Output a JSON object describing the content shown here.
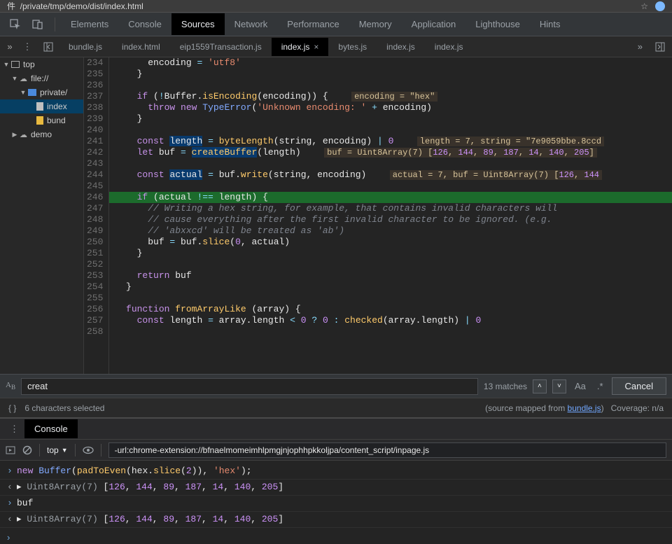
{
  "address_bar": {
    "path": "/private/tmp/demo/dist/index.html"
  },
  "top_tabs": [
    "Elements",
    "Console",
    "Sources",
    "Network",
    "Performance",
    "Memory",
    "Application",
    "Lighthouse",
    "Hints"
  ],
  "active_top_tab": "Sources",
  "file_tabs": [
    "bundle.js",
    "index.html",
    "eip1559Transaction.js",
    "index.js",
    "bytes.js",
    "index.js",
    "index.js"
  ],
  "file_tab_active_index": 3,
  "sidebar": {
    "items": [
      {
        "depth": 0,
        "twisty": "▼",
        "icon": "window",
        "label": "top"
      },
      {
        "depth": 1,
        "twisty": "▼",
        "icon": "cloud",
        "label": "file://"
      },
      {
        "depth": 2,
        "twisty": "▼",
        "icon": "folder",
        "label": "private/"
      },
      {
        "depth": 3,
        "twisty": "",
        "icon": "file",
        "label": "index",
        "hl": true
      },
      {
        "depth": 3,
        "twisty": "",
        "icon": "file-y",
        "label": "bund"
      },
      {
        "depth": 1,
        "twisty": "▶",
        "icon": "cloud",
        "label": "demo"
      }
    ]
  },
  "code": {
    "first_line": 234,
    "lines": [
      {
        "n": 234,
        "html": "      encoding <span class='tok-op'>=</span> <span class='tok-str'>'utf8'</span>"
      },
      {
        "n": 235,
        "html": "    }"
      },
      {
        "n": 236,
        "html": ""
      },
      {
        "n": 237,
        "html": "    <span class='tok-kw'>if</span> (<span class='tok-op'>!</span>Buffer.<span class='tok-fn'>isEncoding</span>(encoding)) {   <span class='inline-val'>encoding = \"hex\"</span>"
      },
      {
        "n": 238,
        "html": "      <span class='tok-kw'>throw</span> <span class='tok-kw'>new</span> <span class='tok-type'>TypeError</span>(<span class='tok-str'>'Unknown encoding: '</span> <span class='tok-op'>+</span> encoding)"
      },
      {
        "n": 239,
        "html": "    }"
      },
      {
        "n": 240,
        "html": ""
      },
      {
        "n": 241,
        "html": "    <span class='tok-kw'>const</span> <span class='sel-bg'>length</span> <span class='tok-op'>=</span> <span class='tok-fn'>byteLength</span>(string, encoding) <span class='tok-op'>|</span> <span class='tok-num'>0</span>   <span class='inline-val'>length = 7, string = \"7e9059bbe.8ccd</span>"
      },
      {
        "n": 242,
        "html": "    <span class='tok-kw'>let</span> buf <span class='tok-op'>=</span> <span class='tok-fn sel-bg'>createBuffer</span>(length)   <span class='inline-val'>buf = Uint8Array(7) [<span class='tok-num'>126</span>, <span class='tok-num'>144</span>, <span class='tok-num'>89</span>, <span class='tok-num'>187</span>, <span class='tok-num'>14</span>, <span class='tok-num'>140</span>, <span class='tok-num'>205</span>]</span>"
      },
      {
        "n": 243,
        "html": ""
      },
      {
        "n": 244,
        "html": "    <span class='tok-kw'>const</span> <span class='sel-bg'>actual</span> <span class='tok-op'>=</span> buf.<span class='tok-fn'>write</span>(string, encoding)   <span class='inline-val'>actual = 7, buf = Uint8Array(7) [<span class='tok-num'>126</span>, <span class='tok-num'>144</span></span>"
      },
      {
        "n": 245,
        "html": ""
      },
      {
        "n": 246,
        "hl": "green",
        "html": "    <span class='tok-kw'>if</span> (actual <span class='tok-op'>!==</span> length) {"
      },
      {
        "n": 247,
        "html": "      <span class='tok-com'>// Writing a hex string, for example, that contains invalid characters will</span>"
      },
      {
        "n": 248,
        "html": "      <span class='tok-com'>// cause everything after the first invalid character to be ignored. (e.g.</span>"
      },
      {
        "n": 249,
        "html": "      <span class='tok-com'>// 'abxxcd' will be treated as 'ab')</span>"
      },
      {
        "n": 250,
        "html": "      buf <span class='tok-op'>=</span> buf.<span class='tok-fn'>slice</span>(<span class='tok-num'>0</span>, actual)"
      },
      {
        "n": 251,
        "html": "    }"
      },
      {
        "n": 252,
        "html": ""
      },
      {
        "n": 253,
        "html": "    <span class='tok-kw'>return</span> buf"
      },
      {
        "n": 254,
        "html": "  }"
      },
      {
        "n": 255,
        "html": ""
      },
      {
        "n": 256,
        "html": "  <span class='tok-kw'>function</span> <span class='tok-fn'>fromArrayLike</span> (array) {"
      },
      {
        "n": 257,
        "html": "    <span class='tok-kw'>const</span> length <span class='tok-op'>=</span> array.length <span class='tok-op'>&lt;</span> <span class='tok-num'>0</span> <span class='tok-op'>?</span> <span class='tok-num'>0</span> <span class='tok-op'>:</span> <span class='tok-fn'>checked</span>(array.length) <span class='tok-op'>|</span> <span class='tok-num'>0</span>"
      },
      {
        "n": 258,
        "html": ""
      }
    ]
  },
  "search": {
    "value": "creat",
    "matches": "13 matches",
    "case": "Aa",
    "regex": ".*",
    "cancel": "Cancel"
  },
  "status": {
    "selection": "6 characters selected",
    "mapped_prefix": "(source mapped from ",
    "mapped_link": "bundle.js",
    "mapped_suffix": ")",
    "coverage": "Coverage: n/a"
  },
  "console": {
    "tab": "Console",
    "context": "top",
    "filter_value": "-url:chrome-extension://bfnaelmomeimhlpmgjnjophhpkkoljpa/content_script/inpage.js",
    "rows": [
      {
        "pre": "›",
        "cls": "in",
        "html": "<span class='tok-kw'>new</span> <span class='tok-type'>Buffer</span>(<span class='tok-fn'>padToEven</span>(hex.<span class='tok-fn'>slice</span>(<span class='tok-num'>2</span>)), <span class='tok-str'>'hex'</span>);"
      },
      {
        "pre": "‹",
        "cls": "",
        "html": "▸ <span class='tok-com' style='font-style:normal;color:#9aa0a6'>Uint8Array(7)</span> [<span class='tok-num'>126</span>, <span class='tok-num'>144</span>, <span class='tok-num'>89</span>, <span class='tok-num'>187</span>, <span class='tok-num'>14</span>, <span class='tok-num'>140</span>, <span class='tok-num'>205</span>]"
      },
      {
        "pre": "›",
        "cls": "in",
        "html": "buf"
      },
      {
        "pre": "‹",
        "cls": "",
        "html": "▸ <span class='tok-com' style='font-style:normal;color:#9aa0a6'>Uint8Array(7)</span> [<span class='tok-num'>126</span>, <span class='tok-num'>144</span>, <span class='tok-num'>89</span>, <span class='tok-num'>187</span>, <span class='tok-num'>14</span>, <span class='tok-num'>140</span>, <span class='tok-num'>205</span>]"
      }
    ]
  }
}
